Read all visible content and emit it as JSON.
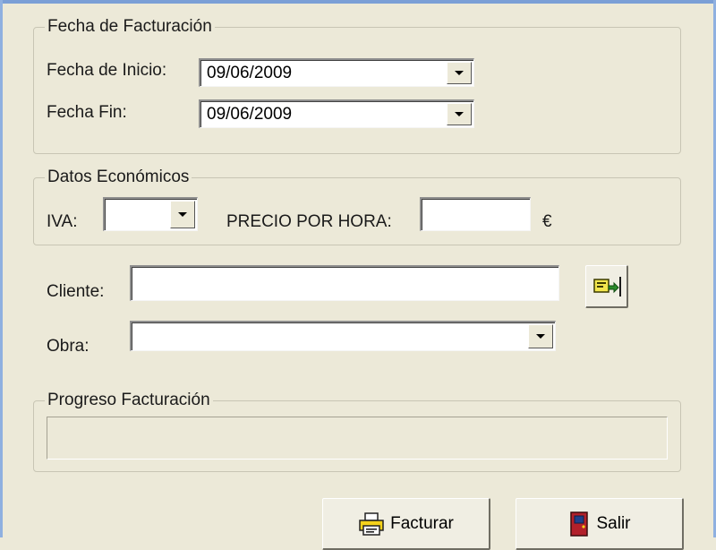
{
  "billing_dates": {
    "title": "Fecha de Facturación",
    "start_label": "Fecha de Inicio:",
    "start_value": "09/06/2009",
    "end_label": "Fecha Fin:",
    "end_value": "09/06/2009"
  },
  "economic_data": {
    "title": "Datos Económicos",
    "iva_label": "IVA:",
    "iva_value": "",
    "price_label": "PRECIO POR HORA:",
    "price_value": "",
    "currency": "€"
  },
  "client": {
    "label": "Cliente:",
    "value": "",
    "search_icon": "client-lookup-icon"
  },
  "work": {
    "label": "Obra:",
    "value": ""
  },
  "progress": {
    "title": "Progreso Facturación",
    "value": 0
  },
  "actions": {
    "invoice_label": "Facturar",
    "invoice_icon": "printer-icon",
    "exit_label": "Salir",
    "exit_icon": "door-icon"
  },
  "colors": {
    "window_bg": "#ece9d8",
    "progress_fill": "#3c9a3c"
  }
}
